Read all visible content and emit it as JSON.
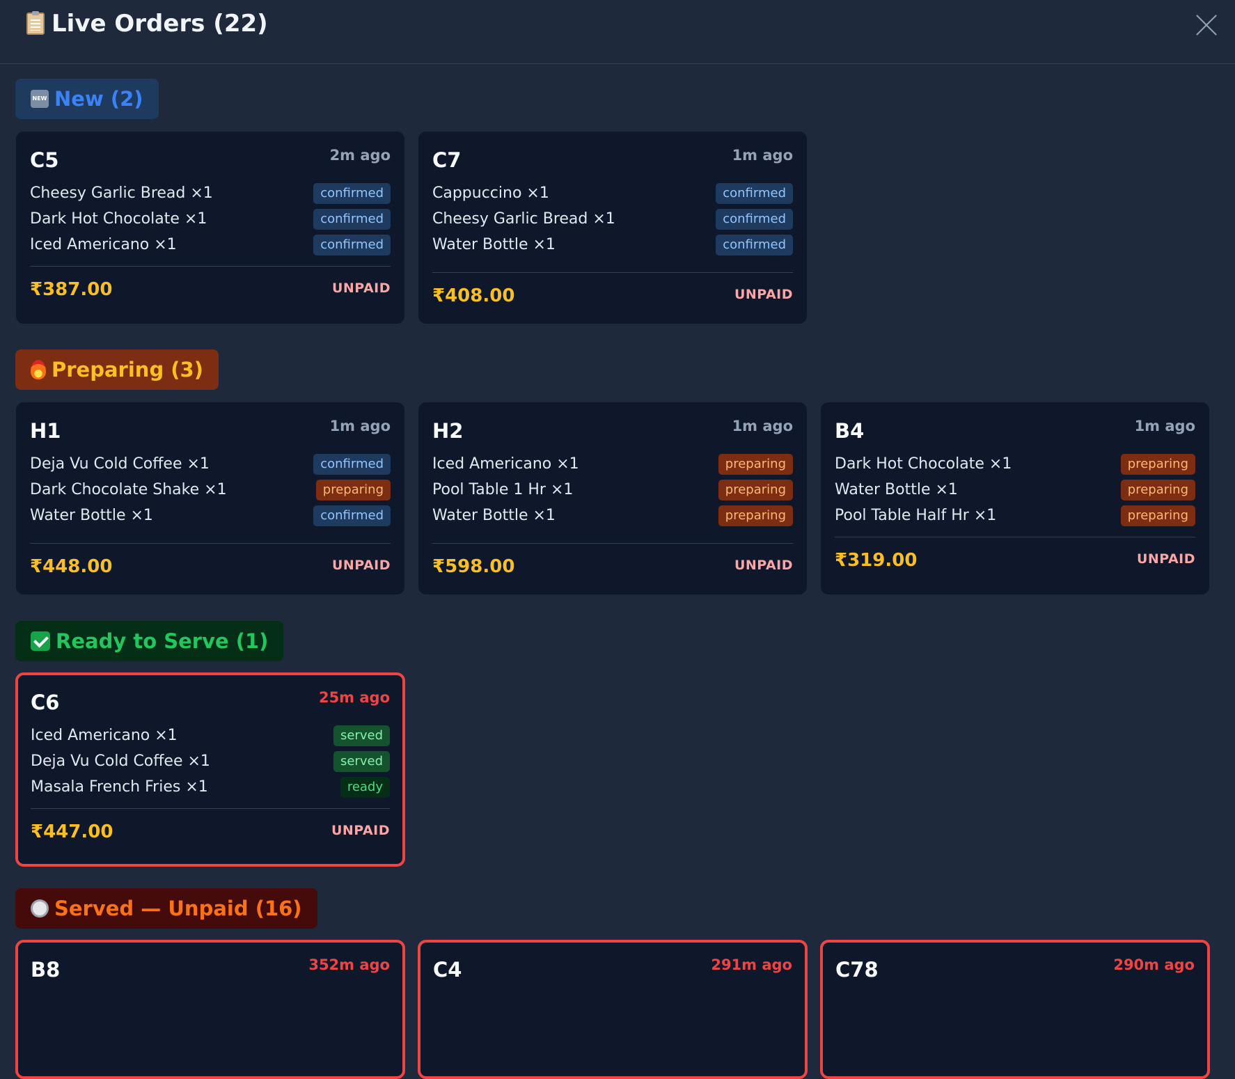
{
  "header": {
    "title": "Live Orders (22)"
  },
  "sections": {
    "new": {
      "label": "New (2)"
    },
    "preparing": {
      "label": "Preparing (3)"
    },
    "ready": {
      "label": "Ready to Serve (1)"
    },
    "served": {
      "label": "Served — Unpaid (16)"
    }
  },
  "orders": {
    "c5": {
      "table": "C5",
      "ago": "2m ago",
      "amount": "₹387.00",
      "payment": "UNPAID",
      "items": [
        {
          "name": "Cheesy Garlic Bread ×1",
          "status": "confirmed"
        },
        {
          "name": "Dark Hot Chocolate ×1",
          "status": "confirmed"
        },
        {
          "name": "Iced Americano ×1",
          "status": "confirmed"
        }
      ]
    },
    "c7": {
      "table": "C7",
      "ago": "1m ago",
      "amount": "₹408.00",
      "payment": "UNPAID",
      "items": [
        {
          "name": "Cappuccino ×1",
          "status": "confirmed"
        },
        {
          "name": "Cheesy Garlic Bread ×1",
          "status": "confirmed"
        },
        {
          "name": "Water Bottle ×1",
          "status": "confirmed"
        }
      ]
    },
    "h1": {
      "table": "H1",
      "ago": "1m ago",
      "amount": "₹448.00",
      "payment": "UNPAID",
      "items": [
        {
          "name": "Deja Vu Cold Coffee ×1",
          "status": "confirmed"
        },
        {
          "name": "Dark Chocolate Shake ×1",
          "status": "preparing"
        },
        {
          "name": "Water Bottle ×1",
          "status": "confirmed"
        }
      ]
    },
    "h2": {
      "table": "H2",
      "ago": "1m ago",
      "amount": "₹598.00",
      "payment": "UNPAID",
      "items": [
        {
          "name": "Iced Americano ×1",
          "status": "preparing"
        },
        {
          "name": "Pool Table 1 Hr ×1",
          "status": "preparing"
        },
        {
          "name": "Water Bottle ×1",
          "status": "preparing"
        }
      ]
    },
    "b4": {
      "table": "B4",
      "ago": "1m ago",
      "amount": "₹319.00",
      "payment": "UNPAID",
      "items": [
        {
          "name": "Dark Hot Chocolate ×1",
          "status": "preparing"
        },
        {
          "name": "Water Bottle ×1",
          "status": "preparing"
        },
        {
          "name": "Pool Table Half Hr ×1",
          "status": "preparing"
        }
      ]
    },
    "c6": {
      "table": "C6",
      "ago": "25m ago",
      "amount": "₹447.00",
      "payment": "UNPAID",
      "items": [
        {
          "name": "Iced Americano ×1",
          "status": "served"
        },
        {
          "name": "Deja Vu Cold Coffee ×1",
          "status": "served"
        },
        {
          "name": "Masala French Fries ×1",
          "status": "ready"
        }
      ]
    },
    "b8": {
      "table": "B8",
      "ago": "352m ago"
    },
    "c4": {
      "table": "C4",
      "ago": "291m ago"
    },
    "c78": {
      "table": "C78",
      "ago": "290m ago"
    }
  },
  "colors": {
    "background": "#1e293b",
    "card": "#0f172a",
    "amount": "#fbbf24",
    "alert_border": "#ef4444"
  }
}
